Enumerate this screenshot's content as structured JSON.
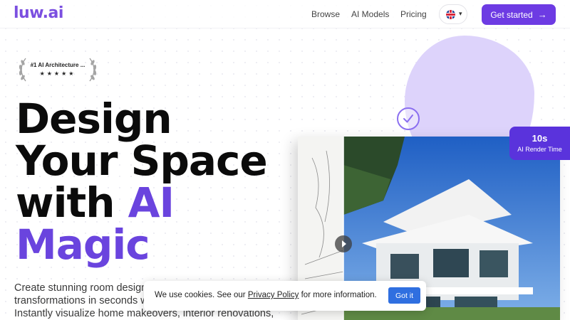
{
  "header": {
    "logo": "luw.ai",
    "nav": [
      "Browse",
      "AI Models",
      "Pricing"
    ],
    "language_chevron": "▾",
    "cta_label": "Get started",
    "cta_arrow": "→"
  },
  "hero": {
    "award_text": "#1 AI Architecture ...",
    "award_stars": "★★★★★",
    "headline_line1": "Design",
    "headline_line2": "Your Space",
    "headline_line3_prefix": "with ",
    "headline_line3_accent": "AI",
    "headline_line4": "Magic",
    "subtitle": "Create stunning room designs and architectural transformations in seconds with our AI-powered platform. Instantly visualize home makeovers, interior renovations,"
  },
  "stat_card": {
    "value": "10s",
    "label": "AI Render Time"
  },
  "cookie": {
    "text_before": "We use cookies. See our ",
    "link": "Privacy Policy",
    "text_after": " for more information.",
    "button": "Got it"
  },
  "icons": [
    "laurel-icon",
    "check-icon",
    "flag-uk-icon",
    "chevron-down-icon",
    "arrow-right-icon",
    "play-icon"
  ],
  "colors": {
    "brand": "#6d3be3",
    "accent_text": "#6a44de",
    "blob": "#ddd3fb",
    "cookie_button": "#2f6fe0"
  }
}
